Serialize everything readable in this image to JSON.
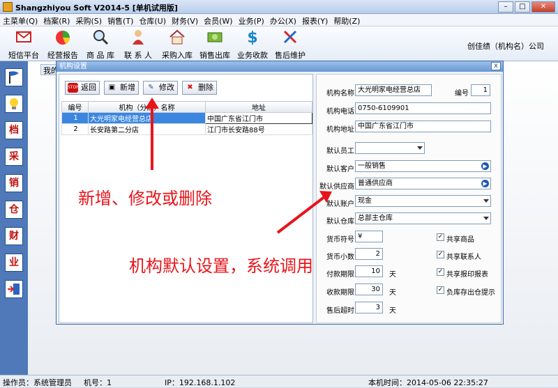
{
  "window": {
    "title": "Shangzhiyou Soft V2014-5 [单机试用版]",
    "minimize": "–",
    "maximize": "□",
    "close": "✕"
  },
  "menu": [
    "主菜单(Q)",
    "档案(R)",
    "采购(S)",
    "销售(T)",
    "仓库(U)",
    "财务(V)",
    "会员(W)",
    "业务(P)",
    "办公(X)",
    "报表(Y)",
    "帮助(Z)"
  ],
  "toolbar": [
    "短信平台",
    "经营报告",
    "商 品 库",
    "联 系 人",
    "采购入库",
    "销售出库",
    "业务收款",
    "售后维护"
  ],
  "org_name": "创佳绩（机构名）公司",
  "sidebar_glyphs": [
    "档",
    "采",
    "销",
    "仓",
    "财",
    "业"
  ],
  "bg_tab": "我的",
  "dialog": {
    "title": "机构设置",
    "close": "x",
    "buttons": {
      "back": "返回",
      "add": "新增",
      "edit": "修改",
      "delete": "删除"
    },
    "button_icons": {
      "back": "STOP",
      "add": "▣",
      "edit": "✎",
      "delete": "✖"
    },
    "table": {
      "headers": [
        "编号",
        "机构（分店）名称",
        "地址"
      ],
      "rows": [
        {
          "no": "1",
          "name": "大光明家电经营总店",
          "addr": "中国广东省江门市"
        },
        {
          "no": "2",
          "name": "长安路第二分店",
          "addr": "江门市长安路88号"
        }
      ]
    },
    "form": {
      "org_name_label": "机构名称",
      "org_name": "大光明家电经营总店",
      "id_label": "编号",
      "id": "1",
      "phone_label": "机构电话",
      "phone": "0750-6109901",
      "address_label": "机构地址",
      "address": "中国广东省江门市",
      "staff_label": "默认员工",
      "staff": "",
      "customer_label": "默认客户",
      "customer": "一般销售",
      "supplier_label": "默认供应商",
      "supplier": "普通供应商",
      "account_label": "默认账户",
      "account": "现金",
      "warehouse_label": "默认仓库",
      "warehouse": "总部主仓库",
      "currency_label": "货币符号",
      "currency": "¥",
      "decimals_label": "货币小数",
      "decimals": "2",
      "pay_label": "付款期限",
      "pay": "10",
      "collect_label": "收款期限",
      "collect": "30",
      "service_label": "售后超时",
      "service": "3",
      "day": "天",
      "check_mark": "✓",
      "checks": [
        "共享商品",
        "共享联系人",
        "共享报印报表",
        "负库存出仓提示"
      ]
    }
  },
  "annotations": {
    "a1": "新增、修改或删除",
    "a2": "机构默认设置，系统调用"
  },
  "status": {
    "operator": "操作员：系统管理员",
    "machine": "机号：1",
    "ip": "IP：192.168.1.102",
    "time": "本机时间：2014-05-06 22:35:27"
  }
}
